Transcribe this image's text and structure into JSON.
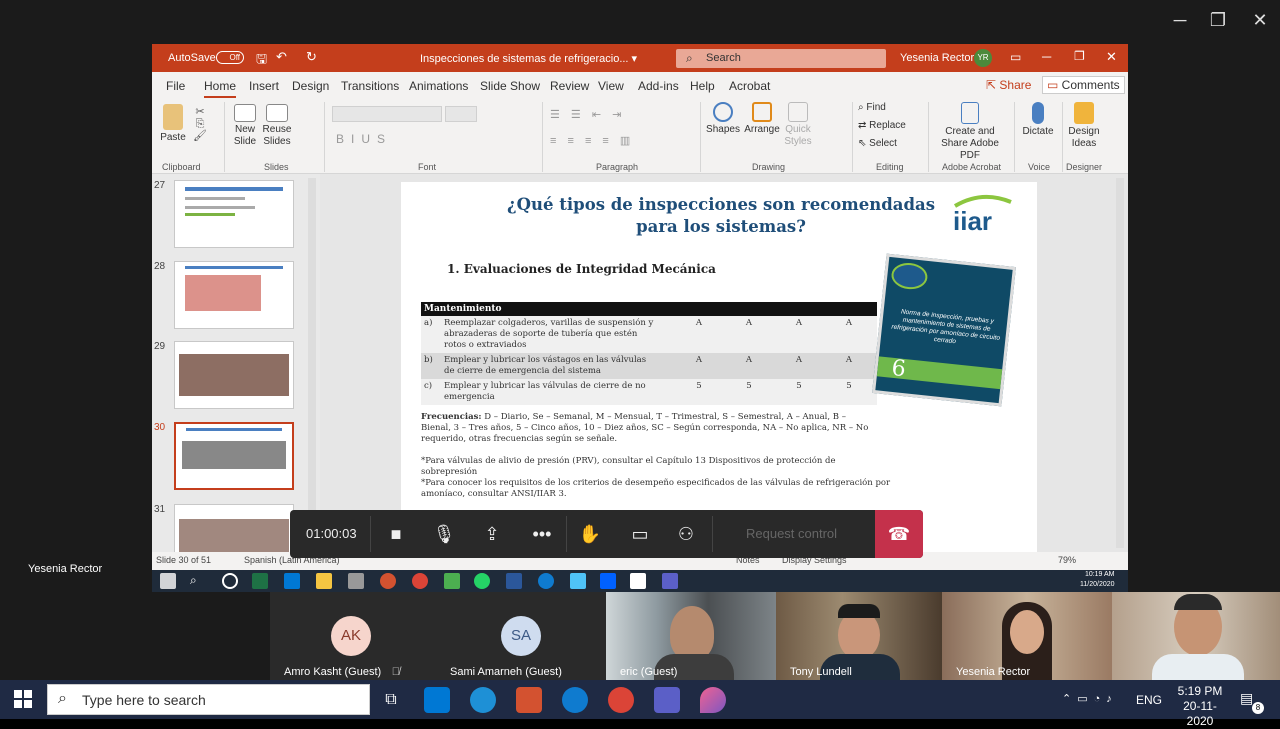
{
  "window": {
    "controls": [
      "─",
      "❐",
      "✕"
    ]
  },
  "ppt": {
    "autosave_label": "AutoSave",
    "autosave_state": "Off",
    "doc_title": "Inspecciones de sistemas de refrigeracio... ▾",
    "search_placeholder": "Search",
    "user_name": "Yesenia Rector",
    "user_initials": "YR",
    "menu": [
      "File",
      "Home",
      "Insert",
      "Design",
      "Transitions",
      "Animations",
      "Slide Show",
      "Review",
      "View",
      "Add-ins",
      "Help",
      "Acrobat"
    ],
    "share_label": "Share",
    "comments_label": "Comments",
    "ribbon": {
      "paste": "Paste",
      "new_slide": "New Slide",
      "reuse_slides": "Reuse Slides",
      "clipboard": "Clipboard",
      "slides": "Slides",
      "font": "Font",
      "paragraph": "Paragraph",
      "shapes": "Shapes",
      "arrange": "Arrange",
      "quick_styles": "Quick Styles",
      "drawing": "Drawing",
      "find": "Find",
      "replace": "Replace",
      "select": "Select",
      "editing": "Editing",
      "create_share": "Create and Share Adobe PDF",
      "adobe_acrobat": "Adobe Acrobat",
      "dictate": "Dictate",
      "voice": "Voice",
      "design_ideas": "Design Ideas",
      "designer": "Designer"
    },
    "thumbnails": [
      {
        "num": "27"
      },
      {
        "num": "28"
      },
      {
        "num": "29"
      },
      {
        "num": "30"
      },
      {
        "num": "31"
      }
    ],
    "slide": {
      "title": "¿Qué tipos de inspecciones son recomendadas para los sistemas?",
      "logo": "iiar",
      "section": "1.    Evaluaciones de Integridad Mecánica",
      "table_header": "Mantenimiento",
      "rows": [
        {
          "id": "a)",
          "text": "Reemplazar colgaderos, varillas de suspensión y abrazaderas de soporte de tubería que estén rotos o extraviados",
          "vals": [
            "A",
            "A",
            "A",
            "A"
          ]
        },
        {
          "id": "b)",
          "text": "Emplear y lubricar los vástagos en las válvulas de cierre de emergencia del sistema",
          "vals": [
            "A",
            "A",
            "A",
            "A"
          ]
        },
        {
          "id": "c)",
          "text": "Emplear y lubricar las válvulas de cierre de no emergencia",
          "vals": [
            "5",
            "5",
            "5",
            "5"
          ]
        }
      ],
      "freq_label": "Frecuencias:",
      "freq_text": " D – Diario, Se – Semanal, M – Mensual, T – Trimestral, S – Semestral, A – Anual, B – Bienal, 3 – Tres años, 5 – Cinco años, 10 – Diez años, SC – Según corresponda, NA – No aplica, NR – No requerido, otras frecuencias según se señale.",
      "note1": "*Para válvulas de alivio de presión (PRV), consultar el Capítulo 13 Dispositivos de protección de sobrepresión",
      "note2": "*Para conocer los requisitos de los criterios de desempeño especificados de las válvulas de refrigeración por amoníaco, consultar ANSI/IIAR 3.",
      "book_text": "Norma de inspección, pruebas y mantenimiento de sistemas de refrigeración por amoníaco de circuito cerrado",
      "book_number": "6"
    },
    "status": {
      "slide_info": "Slide 30 of 51",
      "language": "Spanish (Latin America)",
      "notes": "Notes",
      "display": "Display Settings",
      "zoom": "79%"
    },
    "clock_time": "10:19 AM",
    "clock_date": "11/20/2020"
  },
  "presenter_label": "Yesenia Rector",
  "meeting": {
    "timer": "01:00:03",
    "request_control": "Request control"
  },
  "participants": [
    {
      "initials": "AK",
      "name": "Amro Kasht (Guest)",
      "color": "#f6d5cc",
      "text_color": "#8a3a2a"
    },
    {
      "initials": "SA",
      "name": "Sami Amarneh (Guest)",
      "color": "#cfdcef",
      "text_color": "#3d5a86"
    },
    {
      "name": "eric (Guest)"
    },
    {
      "name": "Tony Lundell"
    },
    {
      "name": "Yesenia Rector"
    },
    {
      "name": ""
    }
  ],
  "taskbar": {
    "search_placeholder": "Type here to search",
    "lang": "ENG",
    "time": "5:19 PM",
    "date": "20-11-2020",
    "notif_count": "8"
  }
}
